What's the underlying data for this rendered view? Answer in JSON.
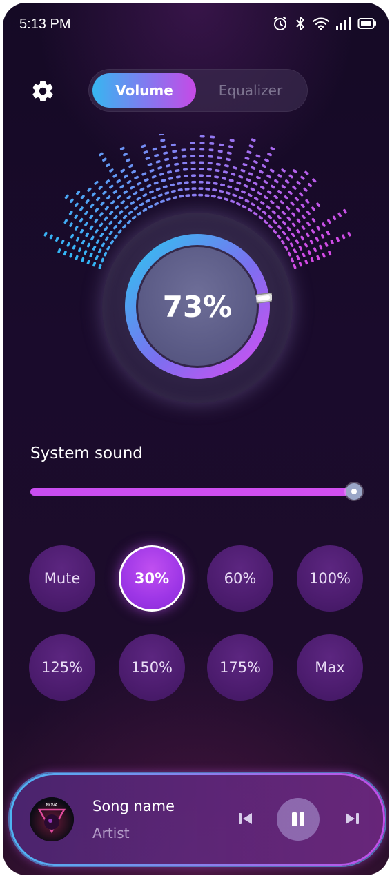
{
  "status": {
    "time": "5:13 PM"
  },
  "tabs": {
    "volume": "Volume",
    "equalizer": "Equalizer"
  },
  "dial": {
    "value_text": "73%",
    "level": 0.73
  },
  "system_sound": {
    "label": "System sound",
    "level": 0.98
  },
  "presets": [
    "Mute",
    "30%",
    "60%",
    "100%",
    "125%",
    "150%",
    "175%",
    "Max"
  ],
  "active_preset": "30%",
  "player": {
    "song": "Song name",
    "artist": "Artist",
    "album_text": "NOVA"
  },
  "colors": {
    "accent_blue": "#37b6f0",
    "accent_purple": "#c64ae6",
    "preset_active": "#9d36e6"
  },
  "icons": [
    "gear-icon",
    "alarm-icon",
    "bluetooth-icon",
    "wifi-icon",
    "signal-icon",
    "battery-icon",
    "previous-icon",
    "pause-icon",
    "next-icon"
  ]
}
